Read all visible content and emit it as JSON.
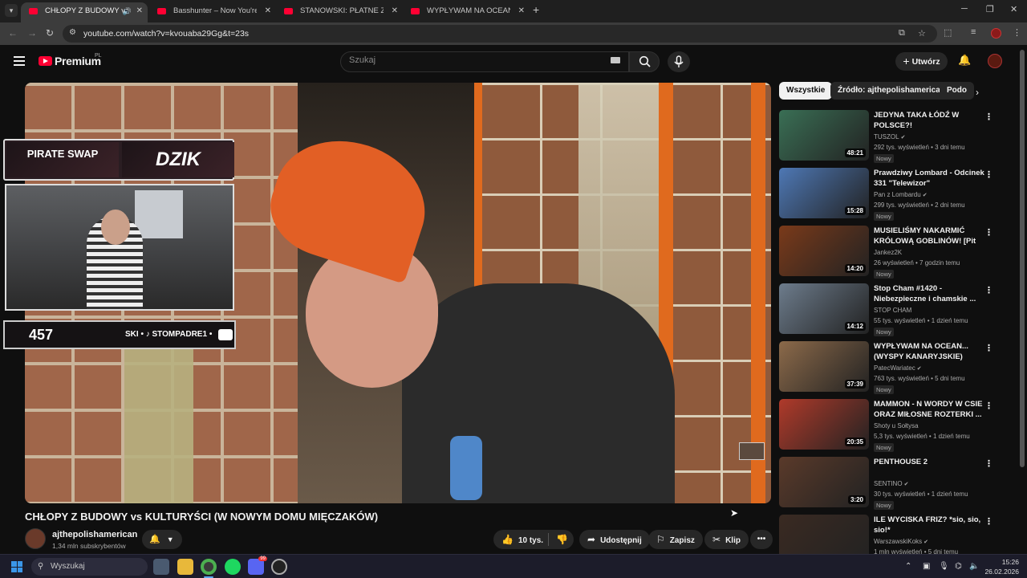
{
  "browser": {
    "tabs": [
      {
        "title": "CHŁOPY Z BUDOWY vs KUL",
        "active": true
      },
      {
        "title": "Basshunter – Now You're Gone",
        "active": false
      },
      {
        "title": "STANOWSKI: PŁATNE ZLECENIE",
        "active": false
      },
      {
        "title": "WYPŁYWAM NA OCEAN... (WYS",
        "active": false
      }
    ],
    "url": "youtube.com/watch?v=kvouaba29Gg&t=23s"
  },
  "masthead": {
    "brand": "Premium",
    "country": "PL",
    "search_placeholder": "Szukaj",
    "create_label": "Utwórz"
  },
  "video": {
    "overlay_sponsor_1": "PIRATE SWAP",
    "overlay_sponsor_2": "DZIK",
    "overlay_count": "457",
    "overlay_ticker": "SKI • ♪ STOMPADRE1 •",
    "title": "CHŁOPY Z BUDOWY vs KULTURYŚCI (W NOWYM DOMU MIĘCZAKÓW)",
    "channel": "ajthepolishamerican",
    "subscribers": "1,34 mln subskrybentów",
    "likes": "10 tys.",
    "share_label": "Udostępnij",
    "save_label": "Zapisz",
    "clip_label": "Klip"
  },
  "sidebar": {
    "chips": [
      "Wszystkie",
      "Źródło: ajthepolishamerican",
      "Podo"
    ],
    "items": [
      {
        "title": "JEDYNA TAKA ŁÓDŹ W POLSCE?!",
        "channel": "TUSZOL",
        "verified": true,
        "meta": "292 tys. wyświetleń • 3 dni temu",
        "badge": "Nowy",
        "duration": "48:21",
        "color": "#3a6f55"
      },
      {
        "title": "Prawdziwy Lombard - Odcinek 331 \"Telewizor\"",
        "channel": "Pan z Lombardu",
        "verified": true,
        "meta": "299 tys. wyświetleń • 2 dni temu",
        "badge": "Nowy",
        "duration": "15:28",
        "color": "#4e78b5"
      },
      {
        "title": "MUSIELIŚMY NAKARMIĆ KRÓLOWĄ GOBLINÓW! [Pit of...",
        "channel": "Jankez2K",
        "verified": false,
        "meta": "26 wyświetleń • 7 godzin temu",
        "badge": "Nowy",
        "duration": "14:20",
        "color": "#7a3a1a"
      },
      {
        "title": "Stop Cham #1420 - Niebezpieczne i chamskie ...",
        "channel": "STOP CHAM",
        "verified": false,
        "meta": "55 tys. wyświetleń • 1 dzień temu",
        "badge": "Nowy",
        "duration": "14:12",
        "color": "#6d7c8c"
      },
      {
        "title": "WYPŁYWAM NA OCEAN... (WYSPY KANARYJSKIE)",
        "channel": "PatecWariatec",
        "verified": true,
        "meta": "763 tys. wyświetleń • 5 dni temu",
        "badge": "Nowy",
        "duration": "37:39",
        "color": "#8c6a4a"
      },
      {
        "title": "MAMMON - N WORDY W CSIE ORAZ MIŁOSNE ROZTERKI ...",
        "channel": "Shoty u Sołtysa",
        "verified": false,
        "meta": "5,3 tys. wyświetleń • 1 dzień temu",
        "badge": "Nowy",
        "duration": "20:35",
        "color": "#b03a2a"
      },
      {
        "title": "PENTHOUSE 2",
        "channel": "SENTINO",
        "verified": true,
        "meta": "30 tys. wyświetleń • 1 dzień temu",
        "badge": "Nowy",
        "duration": "3:20",
        "color": "#5a3a2a"
      },
      {
        "title": "ILE WYCISKA FRIZ? *sio, sio, sio!*",
        "channel": "WarszawskiKoks",
        "verified": true,
        "meta": "1 mln wyświetleń • 5 dni temu",
        "badge": "",
        "duration": "",
        "color": "#3a2a22"
      }
    ]
  },
  "taskbar": {
    "search_label": "Wyszukaj",
    "time": "15:26",
    "date": "26.02.2026",
    "discord_badge": "99"
  },
  "colors": {
    "youtube_red": "#ff0033",
    "background": "#0f0f0f"
  }
}
